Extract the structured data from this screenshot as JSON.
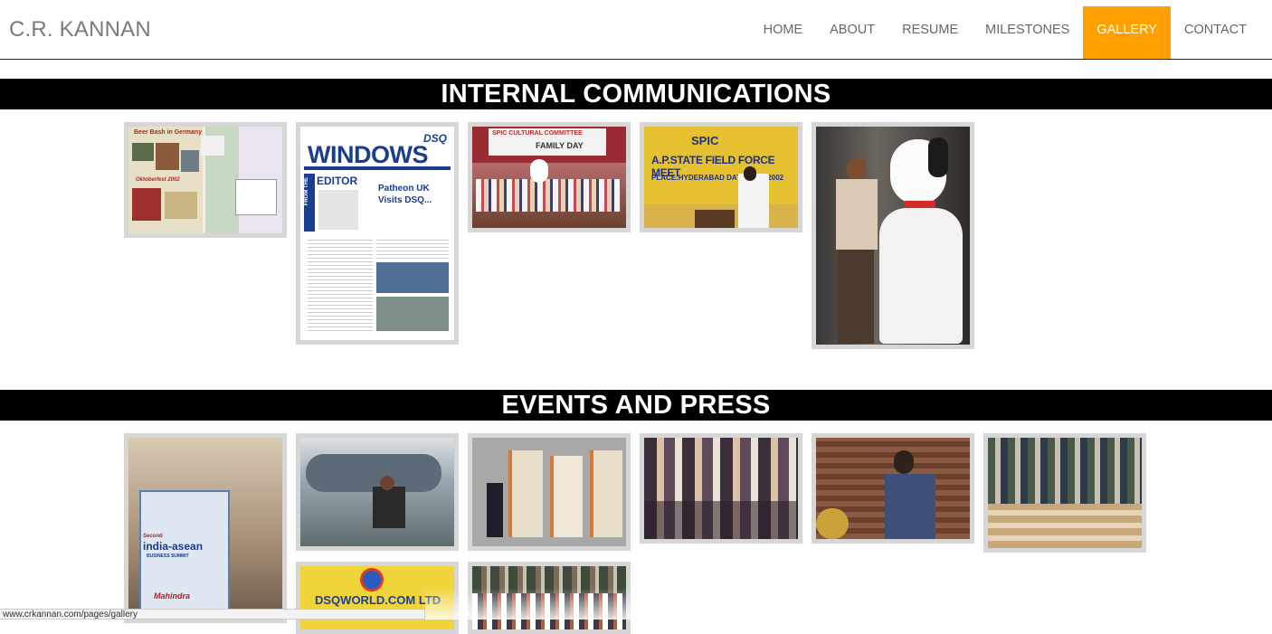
{
  "header": {
    "brand": "C.R. KANNAN",
    "nav": [
      "HOME",
      "ABOUT",
      "RESUME",
      "MILESTONES",
      "GALLERY",
      "CONTACT"
    ],
    "active": "GALLERY"
  },
  "sections": {
    "internal": {
      "title": "INTERNAL COMMUNICATIONS"
    },
    "events": {
      "title": "EVENTS AND PRESS"
    }
  },
  "photo_text": {
    "beer": "Beer Bash in Germany",
    "oktober": "Oktoberfest 2002",
    "windows": "WINDOWS",
    "dsq": "DSQ",
    "editor": "EDITOR",
    "from_the": "FROM THE",
    "patheon": "Patheon UK Visits DSQ...",
    "spic_cultural": "SPIC CULTURAL COMMITTEE",
    "family_day": "FAMILY DAY",
    "spic": "SPIC",
    "field_force": "A.P.STATE FIELD FORCE MEET",
    "place": "PLACE:HYDERABAD  DATE:    MAY 2002",
    "second": "Second",
    "india_asean": "india-asean",
    "summit": "BUSINESS SUMMIT",
    "mahindra": "Mahindra",
    "dsqworld": "DSQWORLD.COM LTD"
  },
  "status": {
    "url": "www.crkannan.com/pages/gallery"
  },
  "colors": {
    "accent": "#ffa000",
    "band": "#000000",
    "frame": "#d6d6d6"
  }
}
